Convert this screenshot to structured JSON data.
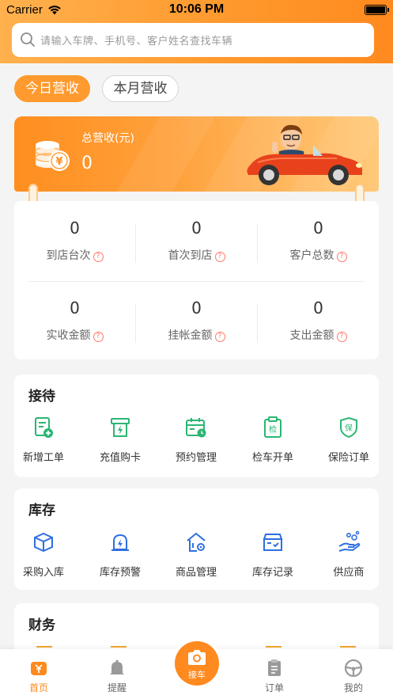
{
  "status_bar": {
    "carrier": "Carrier",
    "time": "10:06 PM"
  },
  "search": {
    "placeholder": "请输入车牌、手机号、客户姓名查找车辆"
  },
  "tabs": [
    {
      "label": "今日营收",
      "active": true
    },
    {
      "label": "本月营收",
      "active": false
    }
  ],
  "revenue": {
    "label": "总营收(元)",
    "value": "0"
  },
  "stats": [
    {
      "value": "0",
      "label": "到店台次"
    },
    {
      "value": "0",
      "label": "首次到店"
    },
    {
      "value": "0",
      "label": "客户总数"
    },
    {
      "value": "0",
      "label": "实收金额"
    },
    {
      "value": "0",
      "label": "挂帐金额"
    },
    {
      "value": "0",
      "label": "支出金额"
    }
  ],
  "help_glyph": "?",
  "sections": {
    "reception": {
      "title": "接待",
      "items": [
        {
          "label": "新增工单",
          "icon": "new-order-icon"
        },
        {
          "label": "充值购卡",
          "icon": "recharge-card-icon"
        },
        {
          "label": "预约管理",
          "icon": "calendar-icon"
        },
        {
          "label": "检车开单",
          "icon": "inspection-clipboard-icon",
          "badge": "检"
        },
        {
          "label": "保险订单",
          "icon": "insurance-shield-icon",
          "badge": "保"
        }
      ]
    },
    "inventory": {
      "title": "库存",
      "items": [
        {
          "label": "采购入库",
          "icon": "box-icon"
        },
        {
          "label": "库存预警",
          "icon": "alert-icon"
        },
        {
          "label": "商品管理",
          "icon": "goods-icon"
        },
        {
          "label": "库存记录",
          "icon": "record-box-icon"
        },
        {
          "label": "供应商",
          "icon": "supplier-hand-icon"
        }
      ]
    },
    "finance": {
      "title": "财务"
    }
  },
  "tabbar": {
    "items": [
      {
        "label": "首页",
        "icon": "home-icon",
        "active": true
      },
      {
        "label": "提醒",
        "icon": "bell-icon"
      },
      {
        "label": "接车",
        "icon": "camera-icon"
      },
      {
        "label": "订单",
        "icon": "clipboard-icon"
      },
      {
        "label": "我的",
        "icon": "steering-wheel-icon"
      }
    ]
  },
  "colors": {
    "accent": "#ff8a1f",
    "green": "#2bb673",
    "blue": "#2f6fe0"
  }
}
